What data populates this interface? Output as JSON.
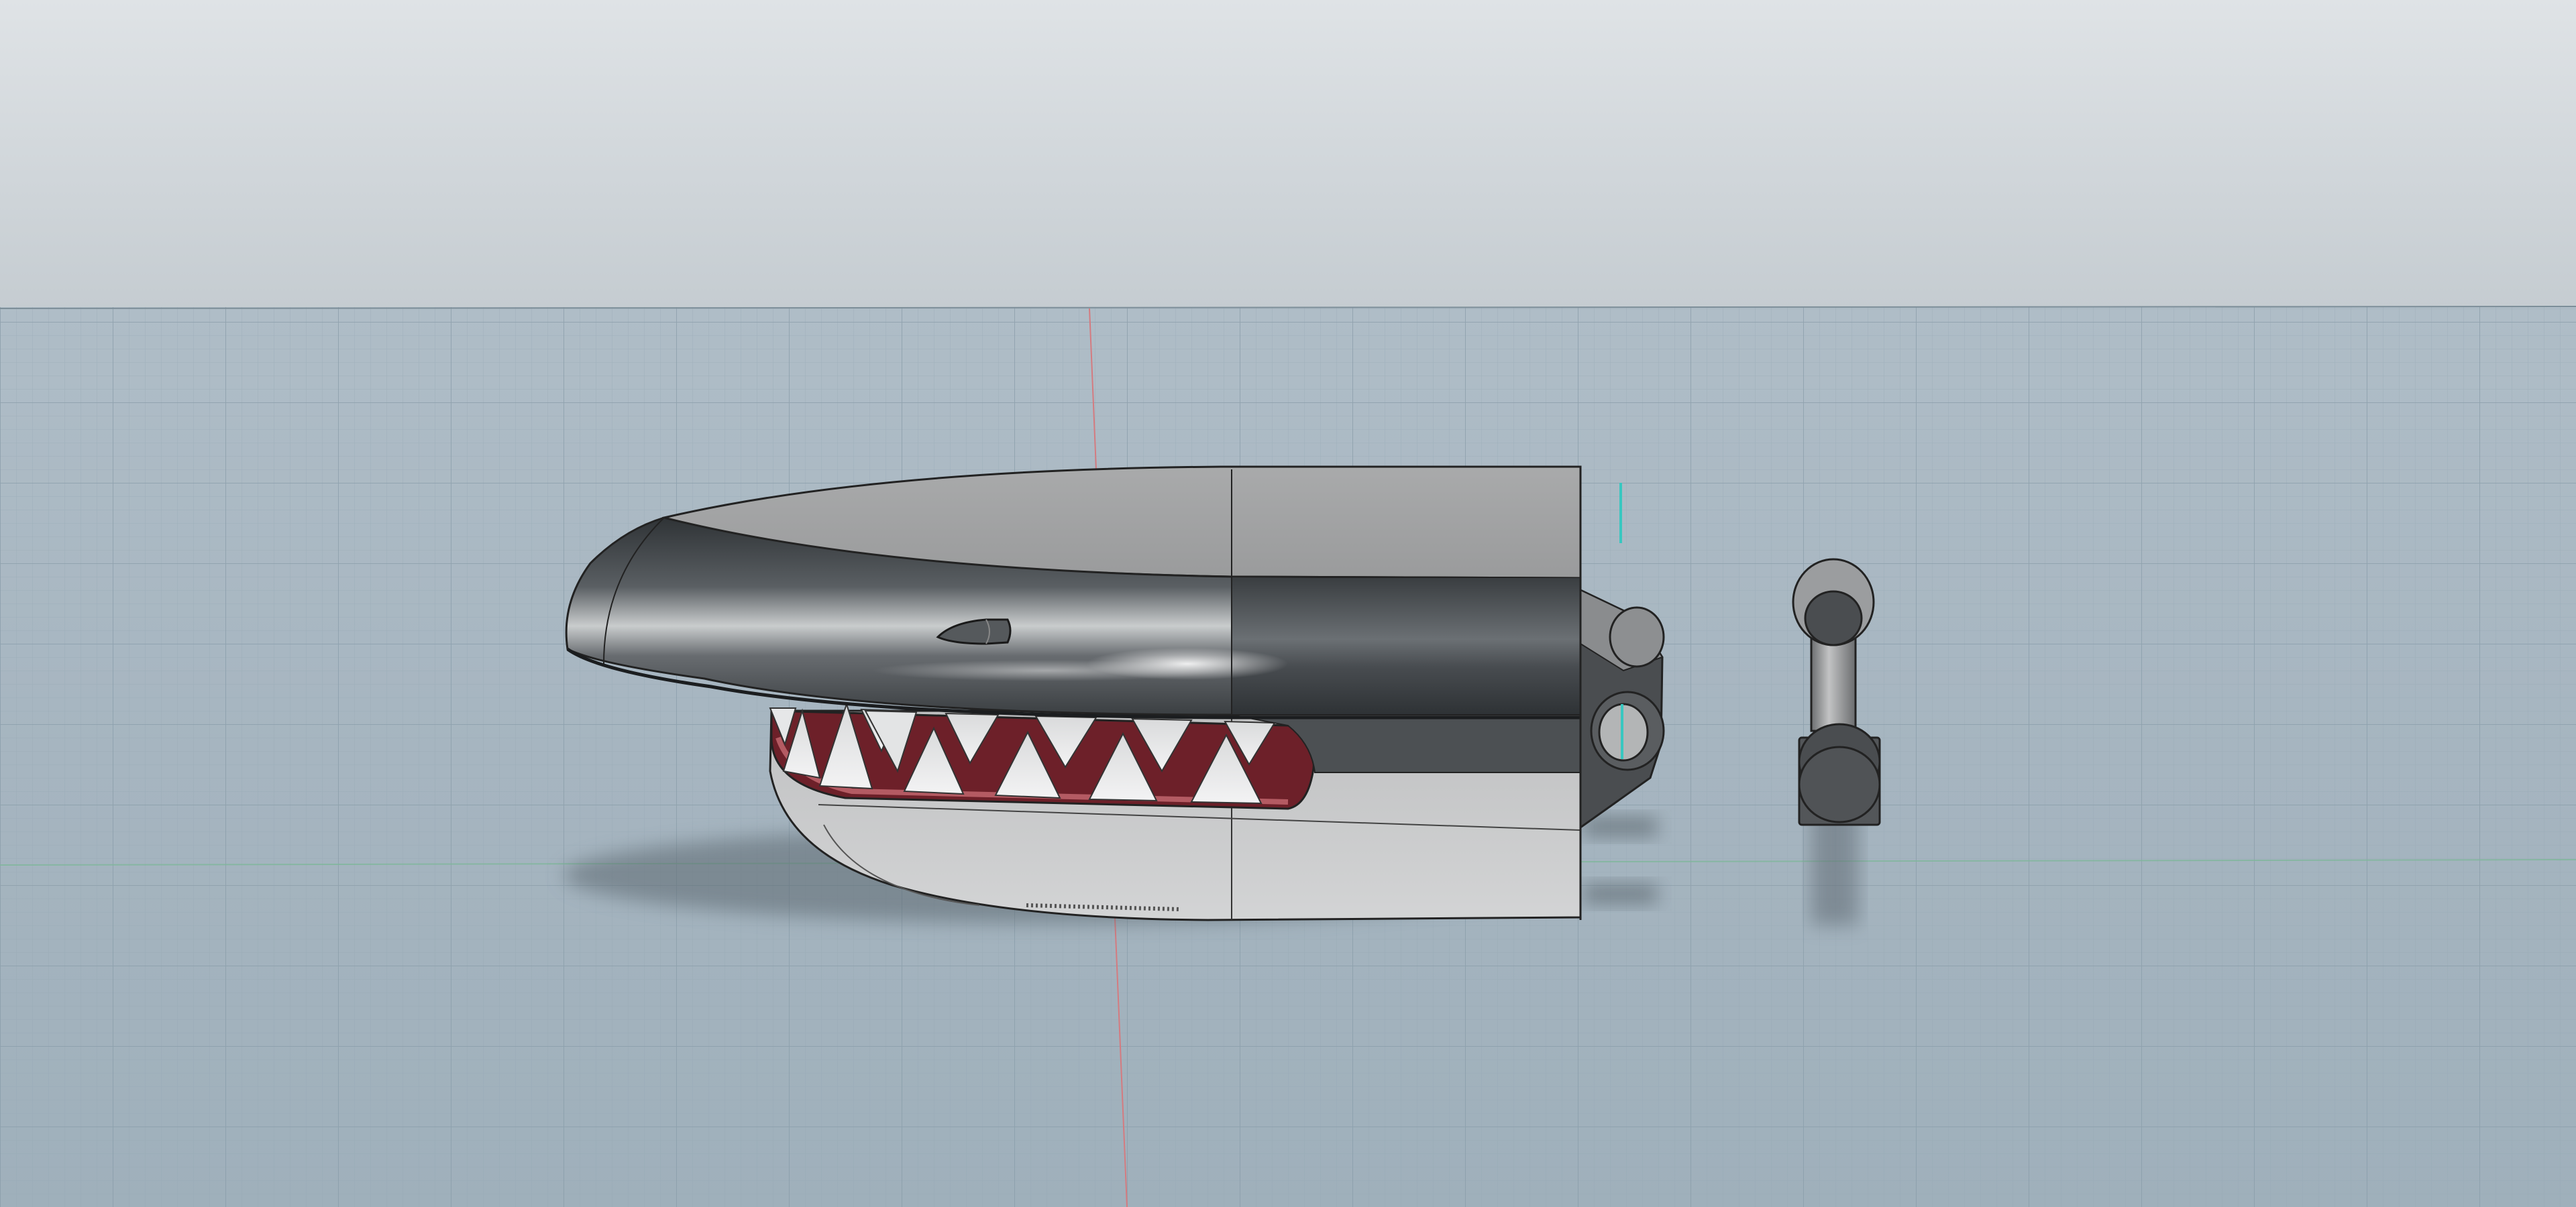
{
  "viewport": {
    "kind": "3d-cad-viewport",
    "background_colors": {
      "sky_top": "#dfe3e6",
      "sky_horizon": "#c5ccd1",
      "ground": "#a6b6c1"
    },
    "grid_visible": true,
    "grid_color": "#8fa3b0",
    "axis_colors": {
      "vertical_axis": "#d47b80",
      "horizontal_axis": "#7fb79b"
    }
  },
  "model": {
    "parts": [
      {
        "name": "head-shell",
        "color": "#4a4e52"
      },
      {
        "name": "upper-jaw-top",
        "color": "#a2a3a4"
      },
      {
        "name": "lower-jaw",
        "color": "#c9cacb"
      },
      {
        "name": "teeth",
        "color": "#e7e8e9",
        "count": 12
      },
      {
        "name": "mouth-interior",
        "color": "#7a2830"
      },
      {
        "name": "hinge-bracket",
        "color": "#4a4d50"
      },
      {
        "name": "hinge-pin",
        "color": "#8e9091"
      }
    ]
  }
}
